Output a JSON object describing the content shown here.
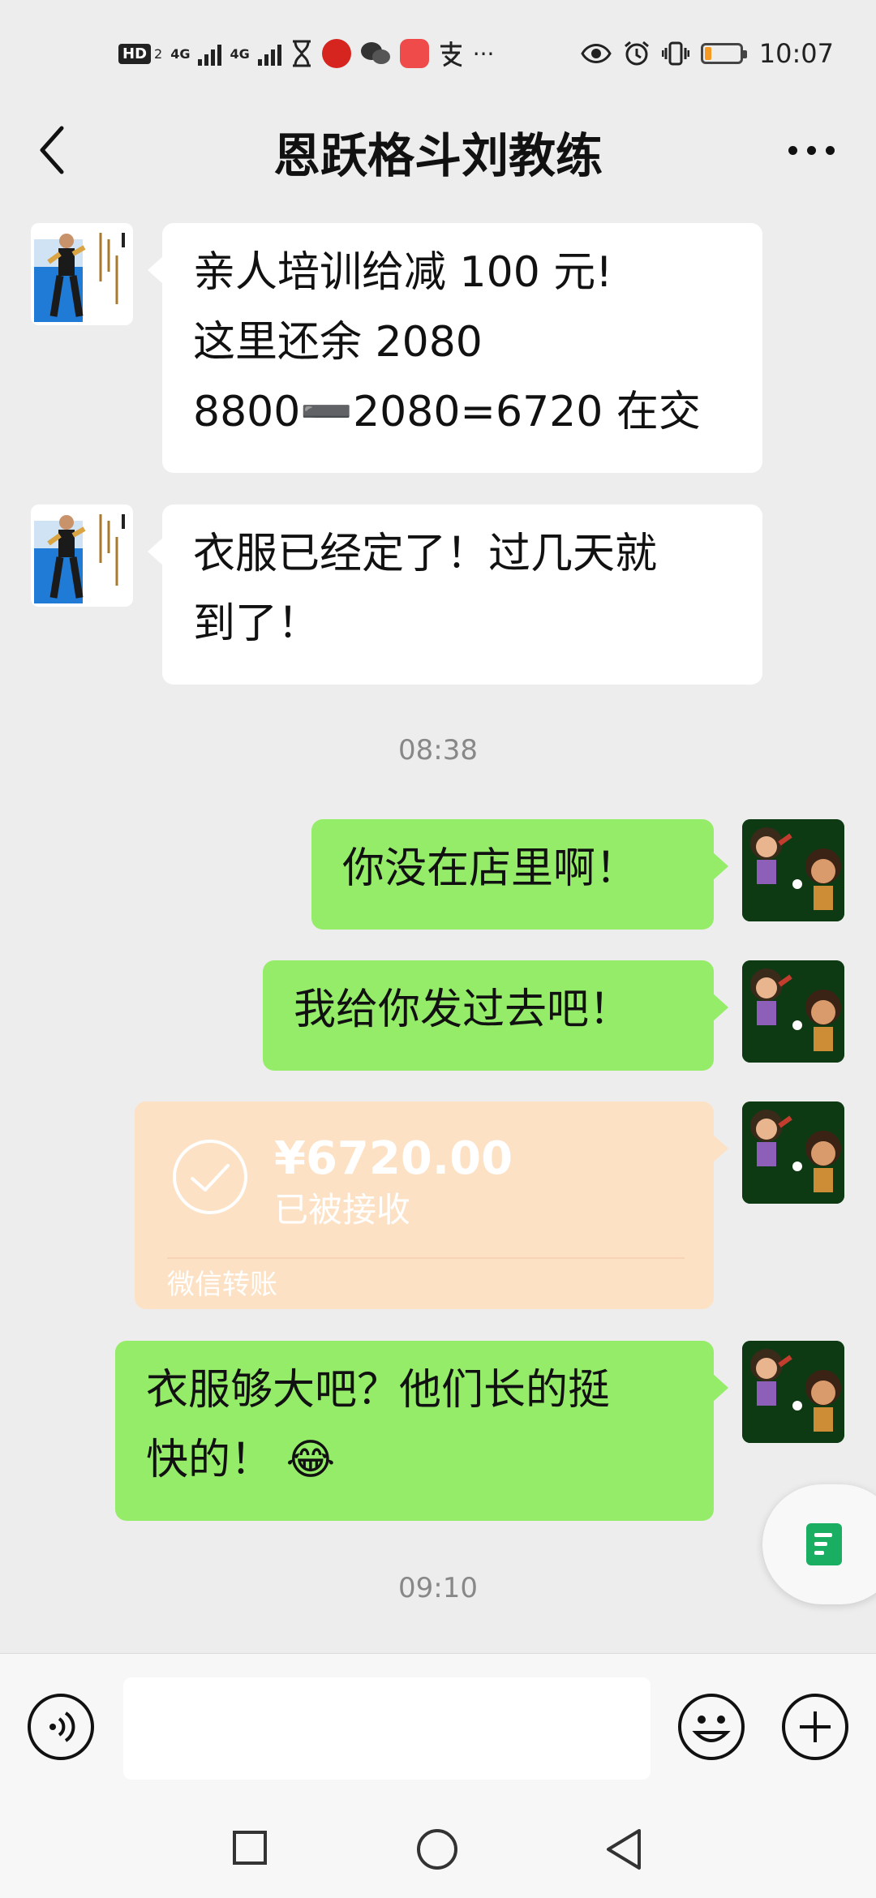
{
  "status_bar": {
    "hd": "HD",
    "sim_index": "2",
    "network_1": "4G",
    "network_2": "4G",
    "overflow": "···",
    "time": "10:07",
    "battery_level": 0.18,
    "battery_color": "#f49a23"
  },
  "header": {
    "title": "恩跃格斗刘教练",
    "back_icon": "chevron-left-icon",
    "more_icon": "more-dots-icon"
  },
  "messages": [
    {
      "from": "coach",
      "lines": [
        "亲人培训给减 100 元!",
        "这里还余 2080",
        "8800➖2080=6720 在交"
      ]
    },
    {
      "from": "coach",
      "lines": [
        "衣服已经定了！过几天就",
        "到了！"
      ]
    },
    {
      "timestamp": "08:38"
    },
    {
      "from": "me",
      "lines": [
        "你没在店里啊！"
      ]
    },
    {
      "from": "me",
      "lines": [
        "我给你发过去吧！"
      ]
    },
    {
      "from": "me",
      "type": "transfer",
      "amount": "¥6720.00",
      "status": "已被接收",
      "label": "微信转账"
    },
    {
      "from": "me",
      "lines": [
        "衣服够大吧？他们长的挺",
        "快的！"
      ],
      "emoji": "😂"
    },
    {
      "timestamp": "09:10"
    }
  ],
  "colors": {
    "background": "#ededed",
    "incoming_bubble": "#ffffff",
    "outgoing_bubble": "#95ec69",
    "transfer_card": "#fde1c4",
    "timestamp": "#888888"
  },
  "input_bar": {
    "placeholder": "",
    "voice_icon": "voice-icon",
    "emoji_icon": "emoji-icon",
    "plus_icon": "plus-icon"
  },
  "nav_bar": {
    "recent_icon": "square-icon",
    "home_icon": "circle-icon",
    "back_icon": "triangle-back-icon"
  }
}
